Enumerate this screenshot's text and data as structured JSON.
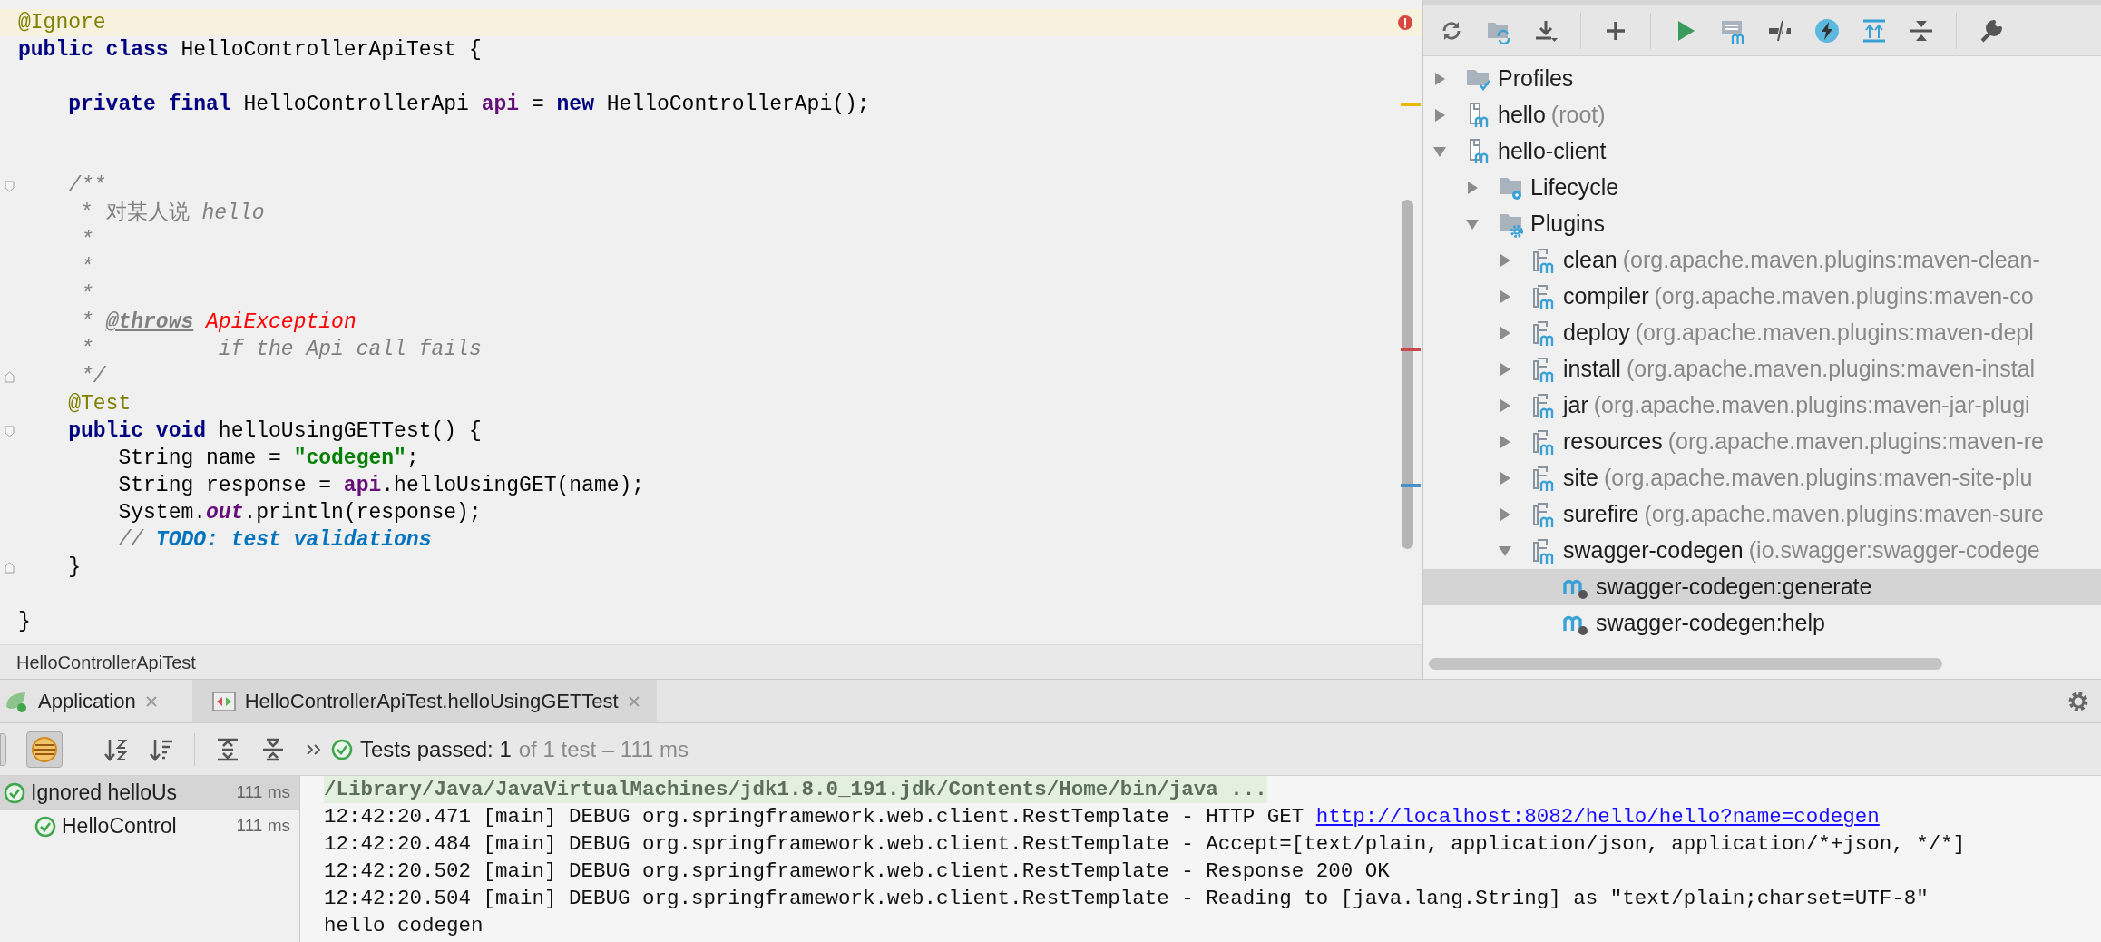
{
  "editor": {
    "lines": [
      {
        "kind": "code",
        "highlighted": true,
        "tokens": [
          {
            "kind": "annotation",
            "text": "@Ignore"
          }
        ]
      },
      {
        "kind": "code",
        "highlighted": false,
        "tokens": [
          {
            "kind": "keyword",
            "text": "public class "
          },
          {
            "kind": "plain",
            "text": "HelloControllerApiTest {"
          }
        ]
      },
      {
        "kind": "blank",
        "highlighted": false
      },
      {
        "kind": "code",
        "highlighted": false,
        "stripe": {
          "color": "#e6b800"
        },
        "tokens": [
          {
            "kind": "keyword",
            "text": "    private final "
          },
          {
            "kind": "plain",
            "text": "HelloControllerApi "
          },
          {
            "kind": "field",
            "text": "api"
          },
          {
            "kind": "plain",
            "text": " = "
          },
          {
            "kind": "keyword",
            "text": "new "
          },
          {
            "kind": "plain",
            "text": "HelloControllerApi();"
          }
        ]
      },
      {
        "kind": "blank",
        "highlighted": false
      },
      {
        "kind": "blank",
        "highlighted": false
      },
      {
        "kind": "code",
        "highlighted": false,
        "fold": {
          "kind": "start"
        },
        "tokens": [
          {
            "kind": "doc",
            "text": "    /**"
          }
        ]
      },
      {
        "kind": "code",
        "highlighted": false,
        "tokens": [
          {
            "kind": "docplain",
            "text": "     * 对某人说 "
          },
          {
            "kind": "doc",
            "text": "hello"
          }
        ]
      },
      {
        "kind": "code",
        "highlighted": false,
        "tokens": [
          {
            "kind": "doc",
            "text": "     *"
          }
        ]
      },
      {
        "kind": "code",
        "highlighted": false,
        "tokens": [
          {
            "kind": "doc",
            "text": "     *"
          }
        ]
      },
      {
        "kind": "code",
        "highlighted": false,
        "tokens": [
          {
            "kind": "doc",
            "text": "     *"
          }
        ]
      },
      {
        "kind": "code",
        "highlighted": false,
        "tokens": [
          {
            "kind": "doc",
            "text": "     * "
          },
          {
            "kind": "doctag",
            "text": "@throws"
          },
          {
            "kind": "docref",
            "text": " ApiException"
          }
        ]
      },
      {
        "kind": "code",
        "highlighted": false,
        "stripe": {
          "color": "#c84a4a"
        },
        "tokens": [
          {
            "kind": "doc",
            "text": "     *          if the Api call fails"
          }
        ]
      },
      {
        "kind": "code",
        "highlighted": false,
        "fold": {
          "kind": "end"
        },
        "tokens": [
          {
            "kind": "doc",
            "text": "     */"
          }
        ]
      },
      {
        "kind": "code",
        "highlighted": false,
        "tokens": [
          {
            "kind": "annotation",
            "text": "    @Test"
          }
        ]
      },
      {
        "kind": "code",
        "highlighted": false,
        "fold": {
          "kind": "start"
        },
        "tokens": [
          {
            "kind": "keyword",
            "text": "    public void "
          },
          {
            "kind": "plain",
            "text": "helloUsingGETTest() {"
          }
        ]
      },
      {
        "kind": "code",
        "highlighted": false,
        "tokens": [
          {
            "kind": "plain",
            "text": "        String name = "
          },
          {
            "kind": "string",
            "text": "\"codegen\""
          },
          {
            "kind": "plain",
            "text": ";"
          }
        ]
      },
      {
        "kind": "code",
        "highlighted": false,
        "stripe": {
          "color": "#4a90c8"
        },
        "tokens": [
          {
            "kind": "plain",
            "text": "        String response = "
          },
          {
            "kind": "field",
            "text": "api"
          },
          {
            "kind": "plain",
            "text": ".helloUsingGET(name);"
          }
        ]
      },
      {
        "kind": "code",
        "highlighted": false,
        "tokens": [
          {
            "kind": "plain",
            "text": "        System."
          },
          {
            "kind": "static",
            "text": "out"
          },
          {
            "kind": "plain",
            "text": ".println(response);"
          }
        ]
      },
      {
        "kind": "code",
        "highlighted": false,
        "tokens": [
          {
            "kind": "comment",
            "text": "        // "
          },
          {
            "kind": "todo",
            "text": "TODO: test validations"
          }
        ]
      },
      {
        "kind": "code",
        "highlighted": false,
        "fold": {
          "kind": "end"
        },
        "tokens": [
          {
            "kind": "plain",
            "text": "    }"
          }
        ]
      },
      {
        "kind": "blank",
        "highlighted": false
      },
      {
        "kind": "code",
        "highlighted": false,
        "tokens": [
          {
            "kind": "plain",
            "text": "}"
          }
        ]
      }
    ],
    "breadcrumb": "HelloControllerApiTest"
  },
  "maven": {
    "tree": [
      {
        "kind": "profiles",
        "label": "Profiles",
        "expanded": false,
        "selected": false
      },
      {
        "kind": "module",
        "label": "hello",
        "detail": "(root)",
        "expanded": false,
        "selected": false
      },
      {
        "kind": "module",
        "label": "hello-client",
        "expanded": true,
        "selected": false,
        "children": [
          {
            "kind": "lifecycle",
            "label": "Lifecycle",
            "expanded": false,
            "selected": false
          },
          {
            "kind": "plugins",
            "label": "Plugins",
            "expanded": true,
            "selected": false,
            "children": [
              {
                "kind": "plugin",
                "label": "clean",
                "detail": "(org.apache.maven.plugins:maven-clean-",
                "expanded": false,
                "selected": false
              },
              {
                "kind": "plugin",
                "label": "compiler",
                "detail": "(org.apache.maven.plugins:maven-co",
                "expanded": false,
                "selected": false
              },
              {
                "kind": "plugin",
                "label": "deploy",
                "detail": "(org.apache.maven.plugins:maven-depl",
                "expanded": false,
                "selected": false
              },
              {
                "kind": "plugin",
                "label": "install",
                "detail": "(org.apache.maven.plugins:maven-instal",
                "expanded": false,
                "selected": false
              },
              {
                "kind": "plugin",
                "label": "jar",
                "detail": "(org.apache.maven.plugins:maven-jar-plugi",
                "expanded": false,
                "selected": false
              },
              {
                "kind": "plugin",
                "label": "resources",
                "detail": "(org.apache.maven.plugins:maven-re",
                "expanded": false,
                "selected": false
              },
              {
                "kind": "plugin",
                "label": "site",
                "detail": "(org.apache.maven.plugins:maven-site-plu",
                "expanded": false,
                "selected": false
              },
              {
                "kind": "plugin",
                "label": "surefire",
                "detail": "(org.apache.maven.plugins:maven-sure",
                "expanded": false,
                "selected": false
              },
              {
                "kind": "plugin",
                "label": "swagger-codegen",
                "detail": "(io.swagger:swagger-codege",
                "expanded": true,
                "selected": false,
                "children": [
                  {
                    "kind": "goal",
                    "label": "swagger-codegen:generate",
                    "selected": true
                  },
                  {
                    "kind": "goal",
                    "label": "swagger-codegen:help",
                    "selected": false
                  }
                ]
              }
            ]
          }
        ]
      }
    ]
  },
  "run": {
    "tabs": [
      {
        "kind": "app",
        "label": "Application",
        "selected": false
      },
      {
        "kind": "test",
        "label": "HelloControllerApiTest.helloUsingGETTest",
        "selected": true
      }
    ],
    "toolbar": {
      "show_passed_on": true
    },
    "status": {
      "passed": true,
      "summary": "Tests passed: 1",
      "detail": "of 1 test – 111 ms"
    },
    "tests": [
      {
        "label": "Ignored helloUs",
        "time": "111 ms",
        "passed": true,
        "selected": true,
        "children": [
          {
            "label": "HelloControl",
            "time": "111 ms",
            "passed": true,
            "selected": false
          }
        ]
      }
    ],
    "console": [
      {
        "kind": "command",
        "text": "/Library/Java/JavaVirtualMachines/jdk1.8.0_191.jdk/Contents/Home/bin/java ..."
      },
      {
        "kind": "log",
        "text": "12:42:20.471 [main] DEBUG org.springframework.web.client.RestTemplate - HTTP GET ",
        "link": "http://localhost:8082/hello/hello?name=codegen"
      },
      {
        "kind": "log",
        "text": "12:42:20.484 [main] DEBUG org.springframework.web.client.RestTemplate - Accept=[text/plain, application/json, application/*+json, */*]"
      },
      {
        "kind": "log",
        "text": "12:42:20.502 [main] DEBUG org.springframework.web.client.RestTemplate - Response 200 OK"
      },
      {
        "kind": "log",
        "text": "12:42:20.504 [main] DEBUG org.springframework.web.client.RestTemplate - Reading to [java.lang.String] as \"text/plain;charset=UTF-8\""
      },
      {
        "kind": "log",
        "text": "hello codegen"
      }
    ]
  }
}
